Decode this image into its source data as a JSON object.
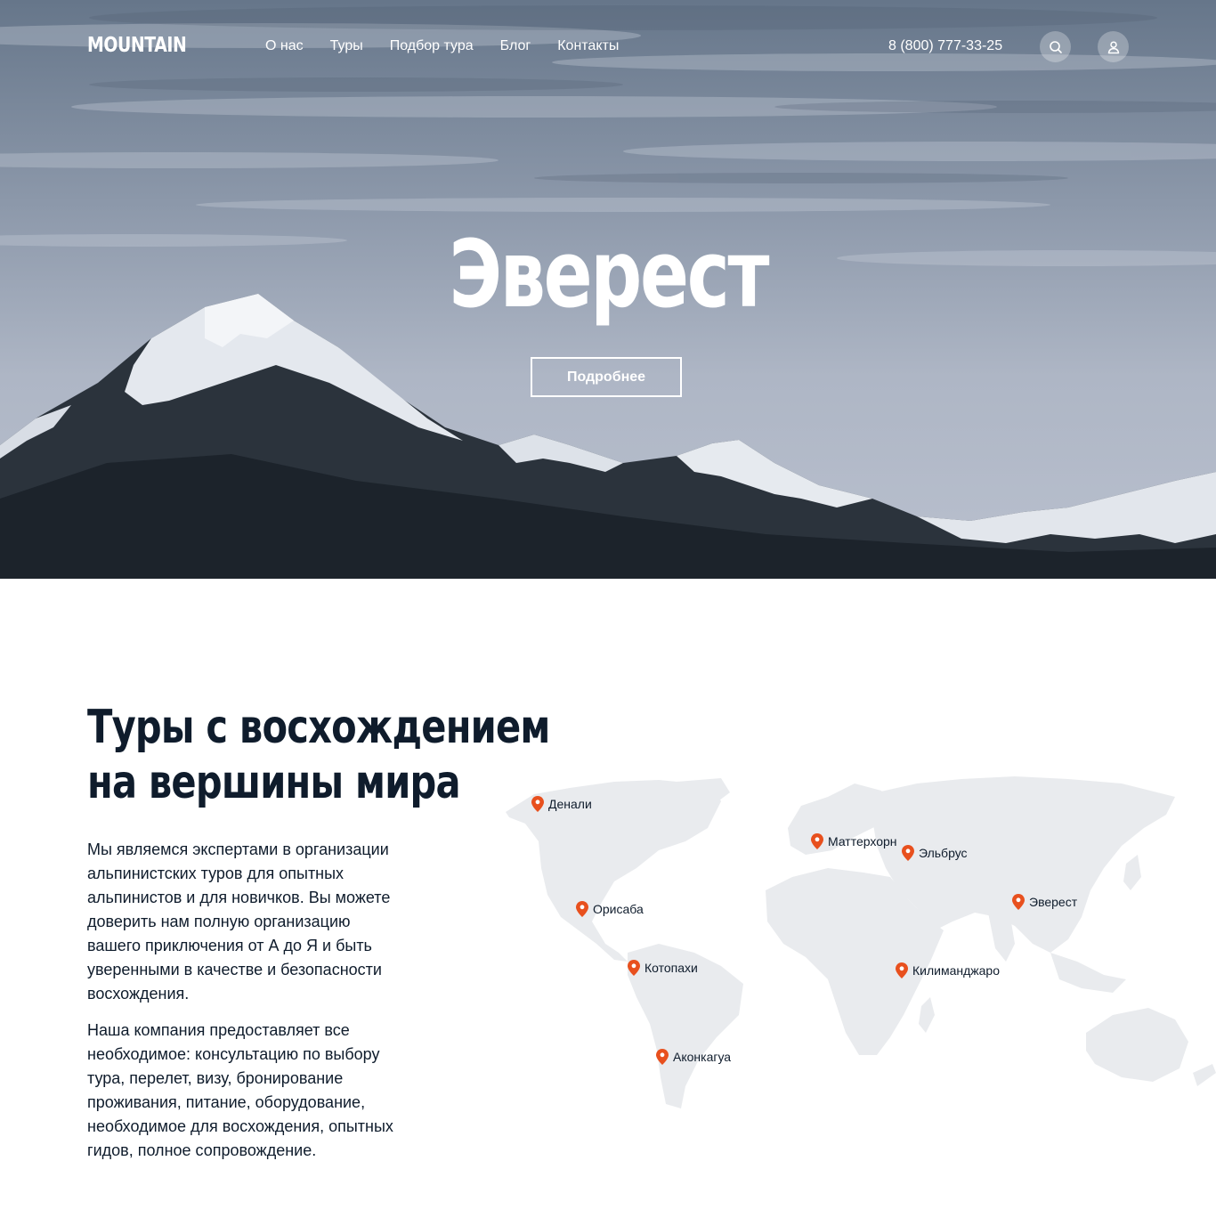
{
  "header": {
    "logo": "MOUNTAIN",
    "menu": [
      "О нас",
      "Туры",
      "Подбор тура",
      "Блог",
      "Контакты"
    ],
    "phone": "8 (800) 777-33-25",
    "icons": [
      "search-icon",
      "user-icon"
    ]
  },
  "hero": {
    "title": "Эверест",
    "button_label": "Подробнее"
  },
  "about": {
    "title_line1": "Туры с восхождением",
    "title_line2": "на вершины мира",
    "paragraph1": "Мы являемся экспертами в организации альпинистских туров для опытных альпинистов и для новичков. Вы можете доверить нам полную организацию вашего приключения от А до Я и быть уверенными в качестве и безопасности восхождения.",
    "paragraph2": "Наша компания предоставляет все необходимое: консультацию по выбору тура, перелет, визу, бронирование проживания, питание, оборудование, необходимое для восхождения, опытных гидов, полное сопровождение."
  },
  "map": {
    "pins": [
      "Денали",
      "Маттерхорн",
      "Эльбрус",
      "Орисаба",
      "Эверест",
      "Котопахи",
      "Килиманджаро",
      "Аконкагуа"
    ]
  },
  "colors": {
    "accent": "#e8501e",
    "dark_text": "#0f1c2c",
    "map_land": "#e9ebee"
  }
}
